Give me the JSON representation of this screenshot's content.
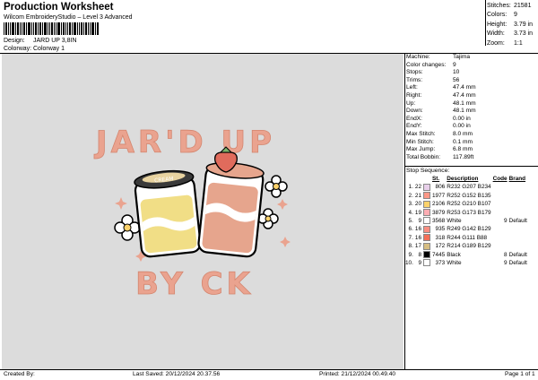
{
  "header": {
    "title": "Production Worksheet",
    "subtitle": "Wilcom EmbroideryStudio – Level 3 Advanced",
    "design_label": "Design:",
    "design_value": "JARD UP 3,8IN",
    "colorway_label": "Colorway:",
    "colorway_value": "Colorway 1"
  },
  "stats": [
    {
      "label": "Stitches:",
      "value": "21581"
    },
    {
      "label": "Colors:",
      "value": "9"
    },
    {
      "label": "Height:",
      "value": "3.79 in"
    },
    {
      "label": "Width:",
      "value": "3.73 in"
    },
    {
      "label": "Zoom:",
      "value": "1:1"
    }
  ],
  "properties": [
    {
      "label": "Machine:",
      "value": "Tajima"
    },
    {
      "label": "Color changes:",
      "value": "9"
    },
    {
      "label": "Stops:",
      "value": "10"
    },
    {
      "label": "Trims:",
      "value": "56"
    },
    {
      "label": "Left:",
      "value": "47.4 mm"
    },
    {
      "label": "Right:",
      "value": "47.4 mm"
    },
    {
      "label": "Up:",
      "value": "48.1 mm"
    },
    {
      "label": "Down:",
      "value": "48.1 mm"
    },
    {
      "label": "EndX:",
      "value": "0.00 in"
    },
    {
      "label": "EndY:",
      "value": "0.00 in"
    },
    {
      "label": "Max Stitch:",
      "value": "8.0 mm"
    },
    {
      "label": "Min Stitch:",
      "value": "0.1 mm"
    },
    {
      "label": "Max Jump:",
      "value": "6.8 mm"
    },
    {
      "label": "Total Bobbin:",
      "value": "117.89ft"
    }
  ],
  "stop_sequence": {
    "title": "Stop Sequence:",
    "headers": {
      "st": "St.",
      "description": "Description",
      "code": "Code",
      "brand": "Brand"
    },
    "rows": [
      {
        "n": "1.",
        "color_no": "22",
        "color": "#e8cfea",
        "st": "806",
        "description": "R232 G207 B234",
        "code": "",
        "brand": ""
      },
      {
        "n": "2.",
        "color_no": "21",
        "color": "#fc9887",
        "st": "1977",
        "description": "R252 G152 B135",
        "code": "",
        "brand": ""
      },
      {
        "n": "3.",
        "color_no": "20",
        "color": "#fcd26b",
        "st": "2106",
        "description": "R252 G210 B107",
        "code": "",
        "brand": ""
      },
      {
        "n": "4.",
        "color_no": "19",
        "color": "#fdadb3",
        "st": "3879",
        "description": "R253 G173 B179",
        "code": "",
        "brand": ""
      },
      {
        "n": "5.",
        "color_no": "9",
        "color": "#ffffff",
        "st": "3568",
        "description": "White",
        "code": "9",
        "brand": "Default"
      },
      {
        "n": "6.",
        "color_no": "16",
        "color": "#f98e81",
        "st": "935",
        "description": "R249 G142 B129",
        "code": "",
        "brand": ""
      },
      {
        "n": "7.",
        "color_no": "16",
        "color": "#f46f58",
        "st": "318",
        "description": "R244 G111 B88",
        "code": "",
        "brand": ""
      },
      {
        "n": "8.",
        "color_no": "17",
        "color": "#d6bd81",
        "st": "172",
        "description": "R214 G189 B129",
        "code": "",
        "brand": ""
      },
      {
        "n": "9.",
        "color_no": "8",
        "color": "#000000",
        "st": "7445",
        "description": "Black",
        "code": "8",
        "brand": "Default"
      },
      {
        "n": "10.",
        "color_no": "9",
        "color": "#ffffff",
        "st": "373",
        "description": "White",
        "code": "9",
        "brand": "Default"
      }
    ]
  },
  "artwork": {
    "top_text": "JAR'D UP",
    "bottom_text": "BY CK",
    "lid_text": "CREAM"
  },
  "footer": {
    "created": "Created By:",
    "saved": "Last Saved: 20/12/2024 20.37.56",
    "printed": "Printed: 21/12/2024 00.49.40",
    "page": "Page 1 of 1"
  }
}
